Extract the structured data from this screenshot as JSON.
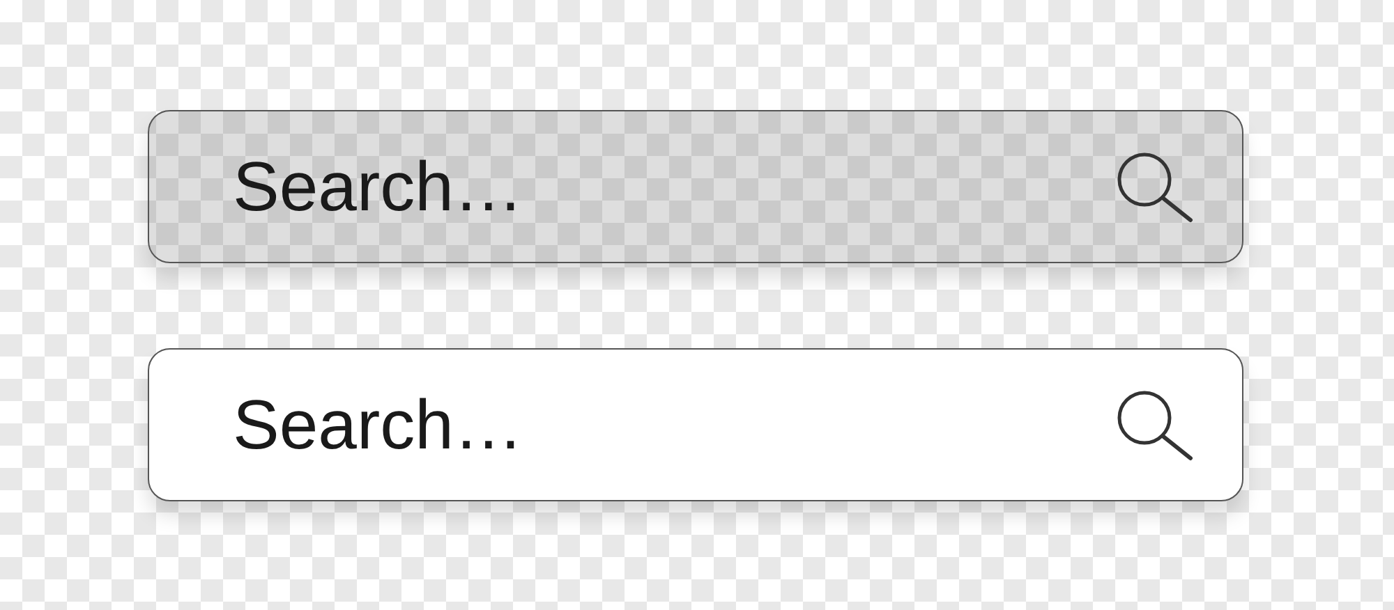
{
  "search_bars": [
    {
      "kind": "translucent",
      "placeholder": "Search…"
    },
    {
      "kind": "solid",
      "placeholder": "Search…"
    }
  ]
}
